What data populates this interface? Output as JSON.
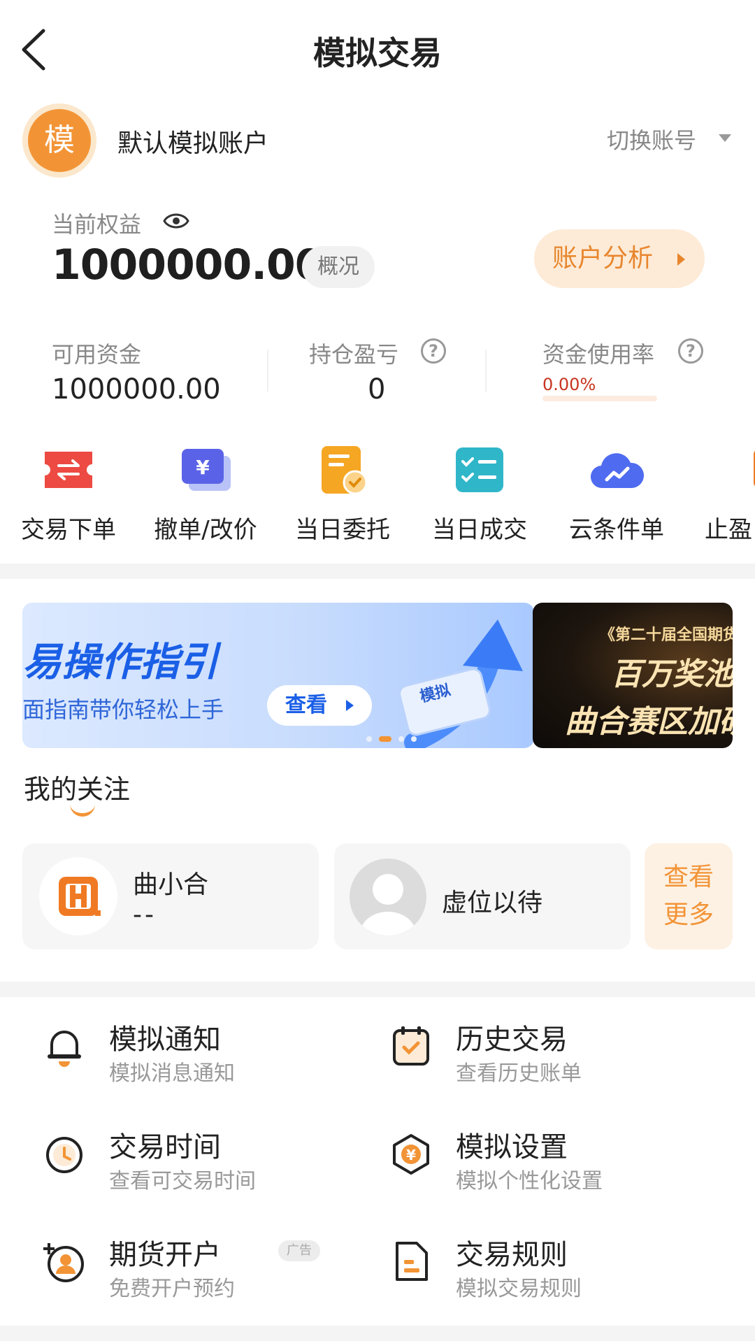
{
  "header": {
    "title": "模拟交易",
    "back_icon": "chevron-left-icon"
  },
  "account": {
    "avatar_char": "模",
    "name": "默认模拟账户",
    "switch_label": "切换账号"
  },
  "equity": {
    "label": "当前权益",
    "value": "1000000.00",
    "overview_label": "概况",
    "analysis_label": "账户分析"
  },
  "stats": {
    "available_label": "可用资金",
    "available_value": "1000000.00",
    "pnl_label": "持仓盈亏",
    "pnl_value": "0",
    "usage_label": "资金使用率",
    "usage_value": "0.00%",
    "usage_fraction": 0.0
  },
  "actions": [
    {
      "label": "交易下单",
      "icon": "exchange-ticket-icon"
    },
    {
      "label": "撤单/改价",
      "icon": "yuan-card-icon"
    },
    {
      "label": "当日委托",
      "icon": "document-check-icon"
    },
    {
      "label": "当日成交",
      "icon": "checklist-icon"
    },
    {
      "label": "云条件单",
      "icon": "cloud-trend-icon"
    },
    {
      "label": "止盈",
      "icon": "stop-profit-icon"
    }
  ],
  "banner": {
    "title": "易操作指引",
    "subtitle": "面指南带你轻松上手",
    "cta": "查看",
    "badge": "模拟",
    "side_line1": "《第二十届全国期货",
    "side_line2": "百万奖池",
    "side_line3": "曲合赛区加研"
  },
  "follow": {
    "title": "我的关注",
    "card1_name": "曲小合",
    "card1_sub": "--",
    "card2_name": "虚位以待",
    "more_line1": "查看",
    "more_line2": "更多"
  },
  "menu": [
    {
      "title": "模拟通知",
      "sub": "模拟消息通知",
      "icon": "bell-icon"
    },
    {
      "title": "历史交易",
      "sub": "查看历史账单",
      "icon": "calendar-check-icon"
    },
    {
      "title": "交易时间",
      "sub": "查看可交易时间",
      "icon": "clock-icon"
    },
    {
      "title": "模拟设置",
      "sub": "模拟个性化设置",
      "icon": "yuan-hexagon-icon"
    },
    {
      "title": "期货开户",
      "sub": "免费开户预约",
      "icon": "add-user-icon",
      "tag": "广告"
    },
    {
      "title": "交易规则",
      "sub": "模拟交易规则",
      "icon": "rules-document-icon"
    }
  ],
  "colors": {
    "accent": "#f29436",
    "text": "#222222",
    "muted": "#888888",
    "usage_red": "#c8341f",
    "banner_blue": "#1a5fe6"
  }
}
